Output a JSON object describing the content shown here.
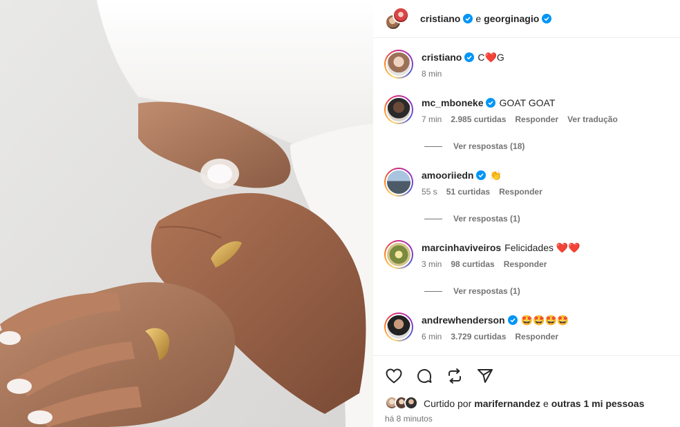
{
  "header": {
    "user1": "cristiano",
    "joiner": "e",
    "user2": "georginagio"
  },
  "comments": [
    {
      "user": "cristiano",
      "verified": true,
      "text": "C❤️G",
      "time": "8 min",
      "likes": "",
      "reply": "",
      "translate": "",
      "replies": ""
    },
    {
      "user": "mc_mboneke",
      "verified": true,
      "text": "GOAT GOAT",
      "time": "7 min",
      "likes": "2.985 curtidas",
      "reply": "Responder",
      "translate": "Ver tradução",
      "replies": "Ver respostas (18)"
    },
    {
      "user": "amooriiedn",
      "verified": true,
      "text": "👏",
      "time": "55 s",
      "likes": "51 curtidas",
      "reply": "Responder",
      "translate": "",
      "replies": "Ver respostas (1)"
    },
    {
      "user": "marcinhaviveiros",
      "verified": false,
      "text": "Felicidades ❤️❤️",
      "time": "3 min",
      "likes": "98 curtidas",
      "reply": "Responder",
      "translate": "",
      "replies": "Ver respostas (1)"
    },
    {
      "user": "andrewhenderson",
      "verified": true,
      "text": "🤩🤩🤩🤩",
      "time": "6 min",
      "likes": "3.729 curtidas",
      "reply": "Responder",
      "translate": "",
      "replies": ""
    }
  ],
  "actions": {
    "icons": [
      "heart-icon",
      "comment-icon",
      "repost-icon",
      "share-icon"
    ]
  },
  "liked": {
    "prefix": "Curtido por",
    "user": "marifernandez",
    "middle": "e",
    "others": "outras 1 mi pessoas"
  },
  "time_ago": "há 8 minutos",
  "colors": {
    "verified": "#0095f6",
    "meta": "#737373",
    "text": "#262626"
  }
}
